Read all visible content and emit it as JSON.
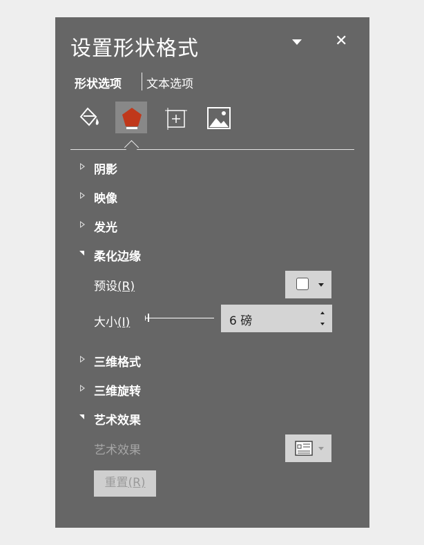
{
  "pane": {
    "title": "设置形状格式",
    "tabs": {
      "shape": "形状选项",
      "text": "文本选项"
    },
    "icons": [
      "fill-line-icon",
      "effects-pentagon-icon",
      "size-properties-icon",
      "picture-icon"
    ],
    "selected_icon": "effects-pentagon-icon",
    "colors": {
      "background": "#666666",
      "selected_tab": "#888888",
      "accent_pentagon": "#c0381b"
    }
  },
  "sections": {
    "shadow": "阴影",
    "reflection": "映像",
    "glow": "发光",
    "soft_edges": "柔化边缘",
    "format_3d": "三维格式",
    "rotation_3d": "三维旋转",
    "artistic": "艺术效果"
  },
  "soft_edges": {
    "preset_label": "预设",
    "preset_key": "(R)",
    "size_label": "大小",
    "size_key": "(I)",
    "size_value": "6 磅"
  },
  "artistic": {
    "effect_label": "艺术效果",
    "reset_label": "重置",
    "reset_key": "(R)"
  }
}
